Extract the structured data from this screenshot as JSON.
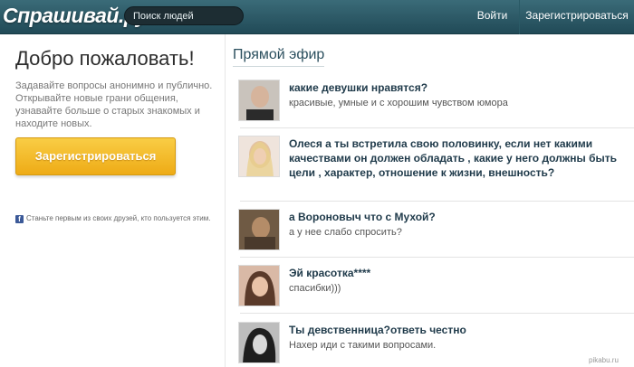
{
  "header": {
    "logo": "Спрашивай.ру",
    "search_placeholder": "Поиск людей",
    "login": "Войти",
    "register": "Зарегистрироваться"
  },
  "welcome": {
    "title": "Добро пожаловать!",
    "description": "Задавайте вопросы анонимно и публично. Открывайте новые грани общения, узнавайте больше о старых знакомых и находите новых.",
    "register_button": "Зарегистрироваться",
    "facebook_note": "Станьте первым из своих друзей, кто пользуется этим."
  },
  "feed": {
    "title": "Прямой эфир",
    "items": [
      {
        "question": "какие девушки нравятся?",
        "answer": "красивые, умные и с хорошим чувством юмора"
      },
      {
        "question": "Олеся а ты встретила свою половинку, если нет какими качествами он должен обладать , какие у него должны быть цели , характер, отношение к жизни, внешность?",
        "answer": ""
      },
      {
        "question": "а Вороновыч что с Мухой?",
        "answer": "а у нее слабо спросить?"
      },
      {
        "question": "Эй красотка****",
        "answer": "спасибки)))"
      },
      {
        "question": "Ты девственница?ответь честно",
        "answer": "Нахер иди с такими вопросами."
      }
    ]
  },
  "watermark": "pikabu.ru",
  "colors": {
    "header": "#214a57",
    "button": "#eeab16",
    "link": "#1f3a4a"
  }
}
